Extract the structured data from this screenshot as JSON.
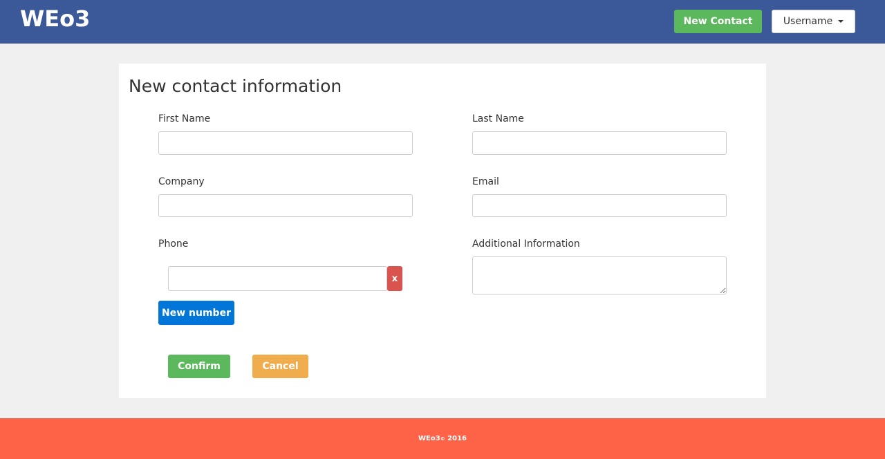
{
  "header": {
    "brand": "WEo3",
    "new_contact_label": "New Contact",
    "username_label": "Username"
  },
  "form": {
    "title": "New contact information",
    "first_name_label": "First Name",
    "last_name_label": "Last Name",
    "company_label": "Company",
    "email_label": "Email",
    "phone_label": "Phone",
    "additional_label": "Additional Information",
    "first_name_value": "",
    "last_name_value": "",
    "company_value": "",
    "email_value": "",
    "phone_value": "",
    "additional_value": "",
    "remove_phone_label": "x",
    "new_number_label": "New number",
    "confirm_label": "Confirm",
    "cancel_label": "Cancel"
  },
  "footer": {
    "brand": "WEo3",
    "copyright_symbol": "©",
    "year": "2016"
  },
  "colors": {
    "navbar": "#3b5998",
    "success": "#5cb85c",
    "danger": "#d9534f",
    "primary": "#0275d8",
    "warning": "#f0ad4e",
    "footer": "#ff6347"
  }
}
